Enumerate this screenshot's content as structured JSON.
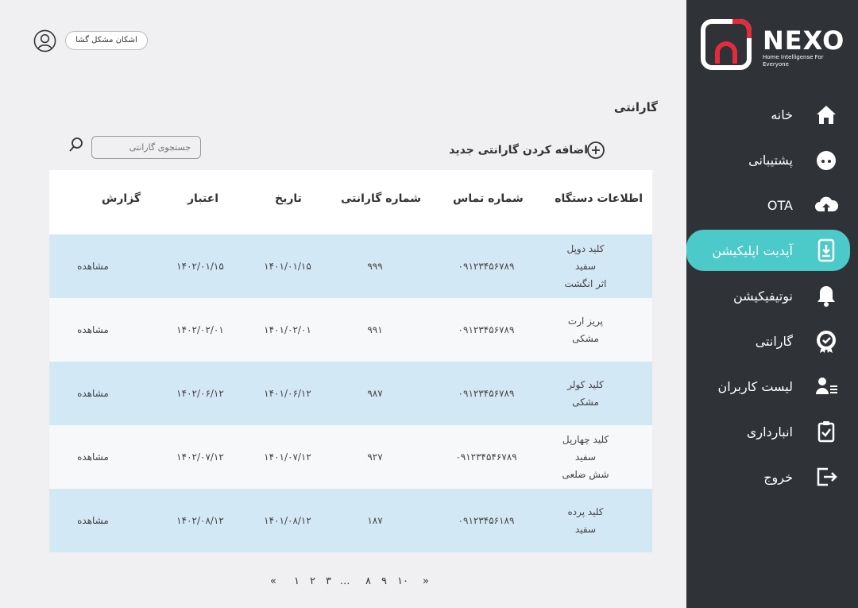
{
  "brand": {
    "name": "NEXO",
    "tagline": "Home Intelligense For Everyone"
  },
  "sidebar": {
    "items": [
      {
        "label": "خانه",
        "icon": "home-icon"
      },
      {
        "label": "پشتیبانی",
        "icon": "support-icon"
      },
      {
        "label": "OTA",
        "icon": "cloud-upload-icon"
      },
      {
        "label": "آپدیت اپلیکیشن",
        "icon": "phone-download-icon",
        "active": true
      },
      {
        "label": "نوتیفیکیشن",
        "icon": "bell-icon"
      },
      {
        "label": "گارانتی",
        "icon": "badge-check-icon"
      },
      {
        "label": "لیست کاربران",
        "icon": "users-list-icon"
      },
      {
        "label": "انبارداری",
        "icon": "clipboard-check-icon"
      },
      {
        "label": "خروج",
        "icon": "logout-icon"
      }
    ]
  },
  "header": {
    "trouble_button": "اشکان مشکل گشا"
  },
  "page": {
    "title": "گارانتی",
    "search_placeholder": "جستجوی گارانتی",
    "add_button": "اضافه کردن گارانتی جدید"
  },
  "table": {
    "columns": [
      "اطلاعات دستگاه",
      "شماره تماس",
      "شماره گارانتی",
      "تاریخ",
      "اعتبار",
      "گزارش"
    ],
    "rows": [
      {
        "device": [
          "کلید دوپل",
          "سفید",
          "اثر انگشت"
        ],
        "phone": "۰۹۱۲۳۴۵۶۷۸۹",
        "warranty": "۹۹۹",
        "date": "۱۴۰۱/۰۱/۱۵",
        "validity": "۱۴۰۲/۰۱/۱۵",
        "report": "مشاهده"
      },
      {
        "device": [
          "پریز ارت",
          "مشکی"
        ],
        "phone": "۰۹۱۲۳۴۵۶۷۸۹",
        "warranty": "۹۹۱",
        "date": "۱۴۰۱/۰۲/۰۱",
        "validity": "۱۴۰۲/۰۲/۰۱",
        "report": "مشاهده"
      },
      {
        "device": [
          "کلید کولر",
          "مشکی"
        ],
        "phone": "۰۹۱۲۳۴۵۶۷۸۹",
        "warranty": "۹۸۷",
        "date": "۱۴۰۱/۰۶/۱۲",
        "validity": "۱۴۰۲/۰۶/۱۲",
        "report": "مشاهده"
      },
      {
        "device": [
          "کلید چهارپل",
          "سفید",
          "شش ضلعی"
        ],
        "phone": "۰۹۱۲۳۴۵۴۶۷۸۹",
        "warranty": "۹۲۷",
        "date": "۱۴۰۱/۰۷/۱۲",
        "validity": "۱۴۰۲/۰۷/۱۲",
        "report": "مشاهده"
      },
      {
        "device": [
          "کلید پرده",
          "سفید"
        ],
        "phone": "۰۹۱۲۳۴۵۶۱۸۹",
        "warranty": "۱۸۷",
        "date": "۱۴۰۱/۰۸/۱۲",
        "validity": "۱۴۰۲/۰۸/۱۲",
        "report": "مشاهده"
      }
    ]
  },
  "pagination": {
    "first": "«",
    "pages": [
      "۱",
      "۲",
      "۳",
      "...",
      "۸",
      "۹",
      "۱۰"
    ],
    "last": "»"
  }
}
